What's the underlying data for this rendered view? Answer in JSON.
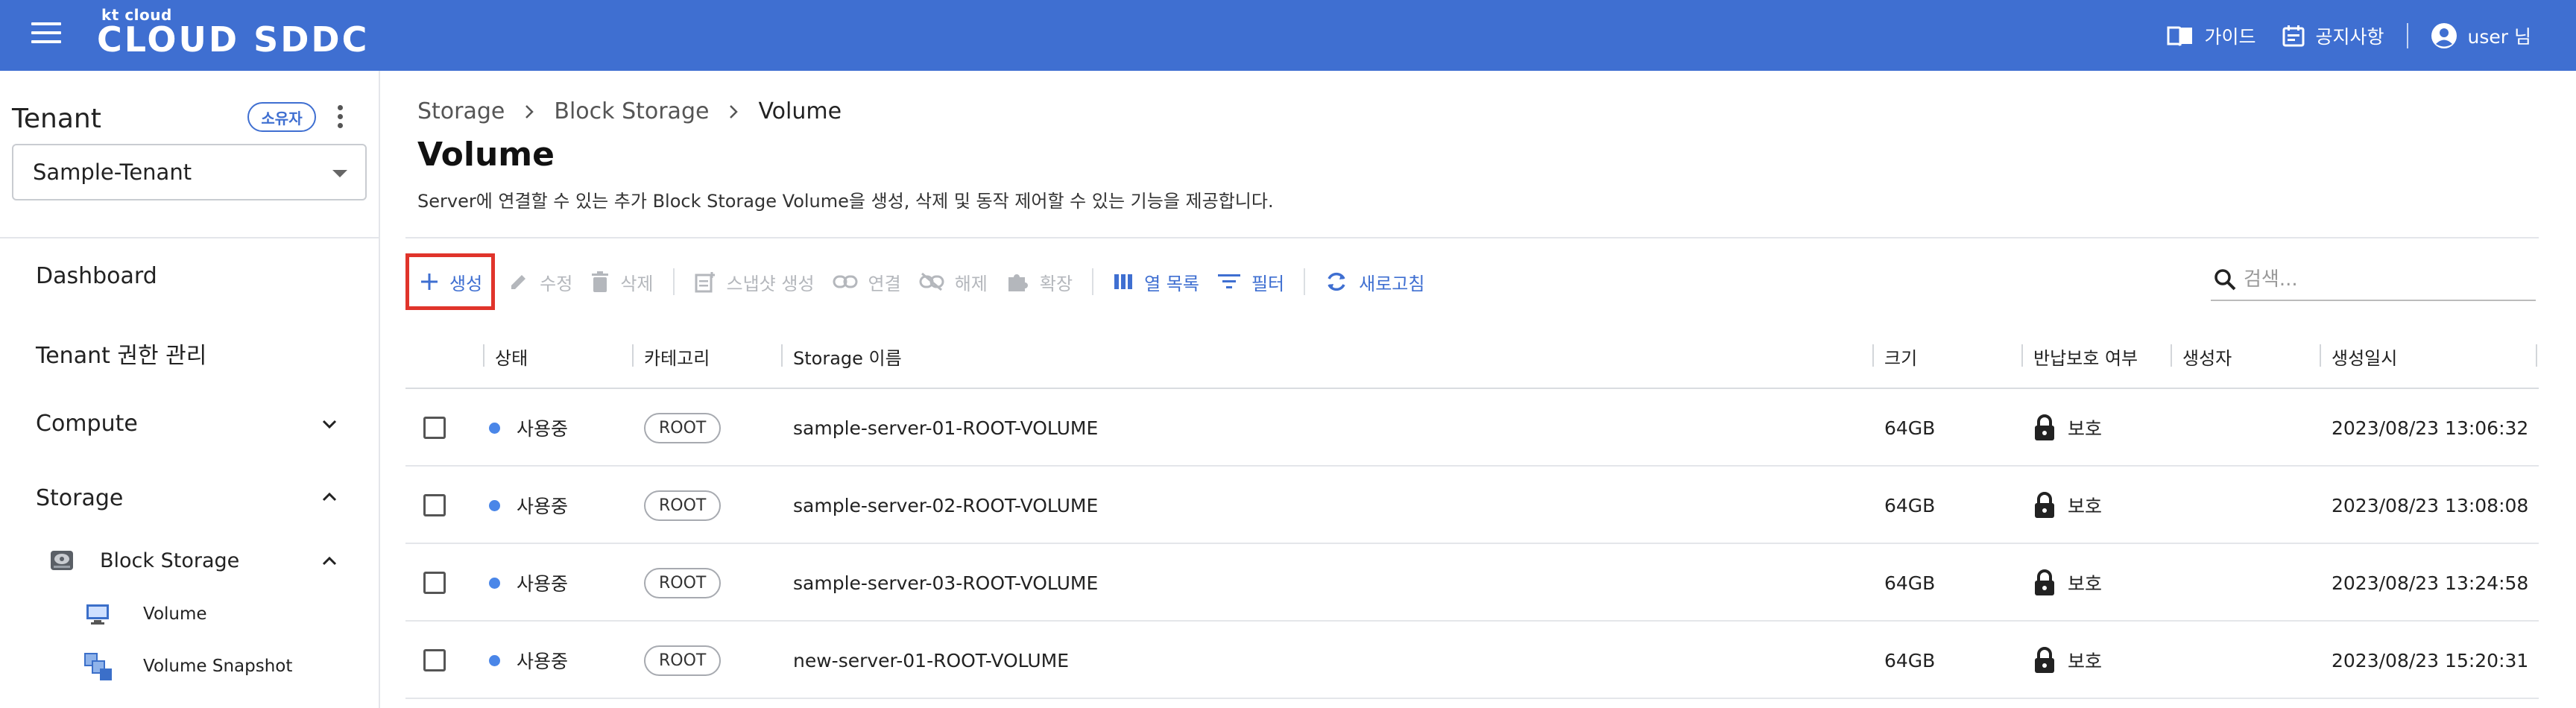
{
  "colors": {
    "brand": "#3f6fd1",
    "highlight": "#e0342b",
    "status_in_use": "#4a86e8"
  },
  "topbar": {
    "brand_small": "kt cloud",
    "brand_big": "CLOUD SDDC",
    "guide_label": "가이드",
    "notice_label": "공지사항",
    "user_label": "user 님"
  },
  "sidebar": {
    "tenant_title": "Tenant",
    "owner_badge": "소유자",
    "tenant_selected": "Sample-Tenant",
    "nav": {
      "dashboard": "Dashboard",
      "tenant_auth": "Tenant 권한 관리",
      "compute": "Compute",
      "storage": "Storage",
      "block_storage": "Block Storage",
      "volume": "Volume",
      "volume_snapshot": "Volume Snapshot"
    }
  },
  "breadcrumb": [
    "Storage",
    "Block Storage",
    "Volume"
  ],
  "page": {
    "title": "Volume",
    "description": "Server에 연결할 수 있는 추가 Block Storage Volume을 생성, 삭제 및 동작 제어할 수 있는 기능을 제공합니다."
  },
  "toolbar": {
    "create": "생성",
    "edit": "수정",
    "delete": "삭제",
    "snapshot": "스냅샷 생성",
    "connect": "연결",
    "disconnect": "해제",
    "expand": "확장",
    "columns": "열 목록",
    "filter": "필터",
    "refresh": "새로고침"
  },
  "search": {
    "placeholder": "검색..."
  },
  "table": {
    "headers": {
      "status": "상태",
      "category": "카테고리",
      "name": "Storage 이름",
      "size": "크기",
      "protect": "반납보호 여부",
      "creator": "생성자",
      "created": "생성일시"
    },
    "rows": [
      {
        "status": "사용중",
        "category": "ROOT",
        "name": "sample-server-01-ROOT-VOLUME",
        "size": "64GB",
        "protect": "보호",
        "creator": "",
        "created": "2023/08/23 13:06:32"
      },
      {
        "status": "사용중",
        "category": "ROOT",
        "name": "sample-server-02-ROOT-VOLUME",
        "size": "64GB",
        "protect": "보호",
        "creator": "",
        "created": "2023/08/23 13:08:08"
      },
      {
        "status": "사용중",
        "category": "ROOT",
        "name": "sample-server-03-ROOT-VOLUME",
        "size": "64GB",
        "protect": "보호",
        "creator": "",
        "created": "2023/08/23 13:24:58"
      },
      {
        "status": "사용중",
        "category": "ROOT",
        "name": "new-server-01-ROOT-VOLUME",
        "size": "64GB",
        "protect": "보호",
        "creator": "",
        "created": "2023/08/23 15:20:31"
      }
    ]
  }
}
